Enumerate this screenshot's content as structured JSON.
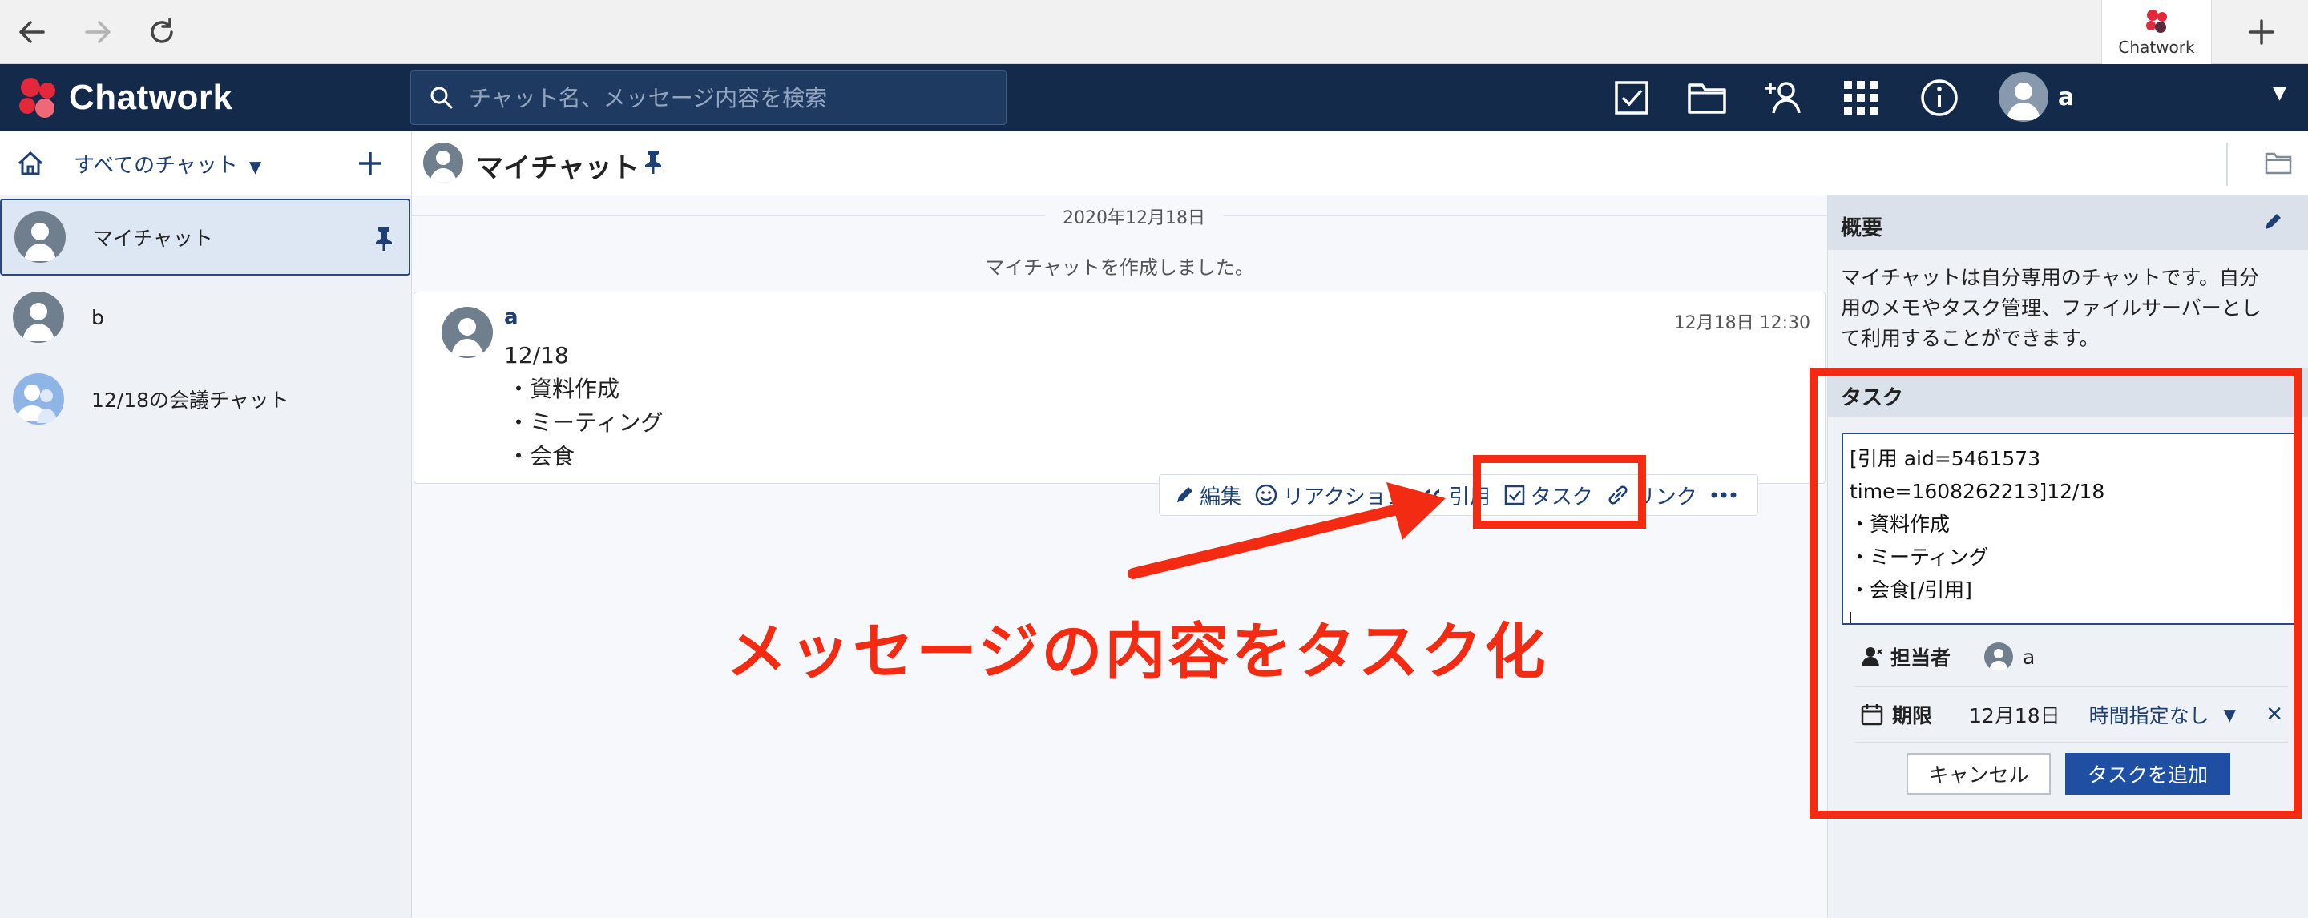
{
  "browser": {
    "tab_label": "Chatwork"
  },
  "header": {
    "logo_text": "Chatwork",
    "search_placeholder": "チャット名、メッセージ内容を検索",
    "user_name": "a",
    "icons": [
      "task-icon",
      "folder-icon",
      "add-contact-icon",
      "apps-grid-icon",
      "info-icon"
    ]
  },
  "sidebar": {
    "filter_label": "すべてのチャット",
    "rooms": [
      {
        "name": "マイチャット",
        "active": true,
        "pinned": true
      },
      {
        "name": "b",
        "active": false,
        "pinned": false
      },
      {
        "name": "12/18の会議チャット",
        "active": false,
        "pinned": false
      }
    ]
  },
  "chat": {
    "title": "マイチャット",
    "date_label": "2020年12月18日",
    "system_message": "マイチャットを作成しました。",
    "message": {
      "author": "a",
      "time": "12月18日 12:30",
      "lines": [
        "12/18",
        "・資料作成",
        "・ミーティング",
        "・会食"
      ]
    },
    "actions": {
      "edit": "編集",
      "reaction": "リアクション",
      "quote": "引用",
      "task": "タスク",
      "link": "リンク"
    }
  },
  "right_panel": {
    "overview_title": "概要",
    "overview_text": "マイチャットは自分専用のチャットです。自分用のメモやタスク管理、ファイルサーバーとして利用することができます。",
    "task_title": "タスク",
    "task_lines": [
      "[引用 aid=5461573 time=1608262213]12/18",
      "・資料作成",
      "・ミーティング",
      "・会食[/引用]"
    ],
    "assignee_label": "担当者",
    "assignee_name": "a",
    "deadline_label": "期限",
    "deadline_date": "12月18日",
    "deadline_time": "時間指定なし",
    "cancel_label": "キャンセル",
    "add_label": "タスクを追加"
  },
  "annotation": {
    "caption": "メッセージの内容をタスク化",
    "color": "#f22b12"
  },
  "colors": {
    "header_bg": "#132a4b",
    "accent": "#1f4fa3",
    "link": "#1d3f73"
  }
}
